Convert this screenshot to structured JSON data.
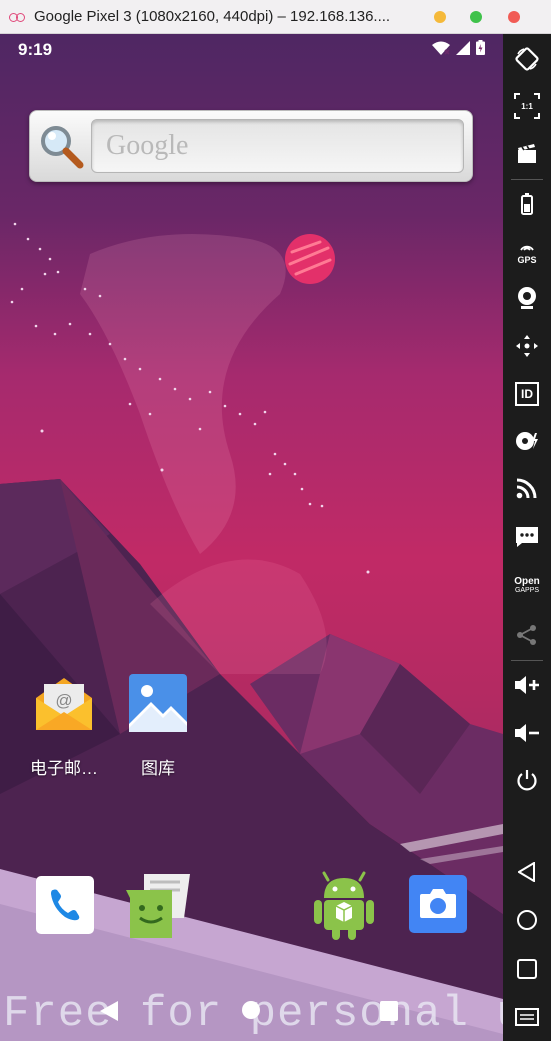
{
  "window": {
    "title": "Google Pixel 3 (1080x2160, 440dpi) – 192.168.136....",
    "buttons": {
      "minimize_color": "#f5b93a",
      "maximize_color": "#3fc24b",
      "close_color": "#f15b55"
    }
  },
  "status_bar": {
    "time": "9:19",
    "icons": [
      "wifi-icon",
      "cell-signal-icon",
      "battery-charging-icon"
    ]
  },
  "search_widget": {
    "placeholder": "Google"
  },
  "apps": [
    {
      "label": "电子邮…",
      "icon": "email-icon"
    },
    {
      "label": "图库",
      "icon": "gallery-icon"
    }
  ],
  "dock": [
    "phone-icon",
    "messaging-icon",
    "android-app-icon",
    "camera-icon"
  ],
  "nav": [
    "back-icon",
    "home-icon",
    "recents-icon"
  ],
  "watermark": "Free for personal use",
  "side_panel": {
    "items": [
      "rotate-icon",
      "pixel-perfect-icon",
      "screencast-icon",
      "battery-icon",
      "gps-icon",
      "webcam-icon",
      "dpad-icon",
      "id-icon",
      "disk-icon",
      "network-icon",
      "sms-icon",
      "open-gapps-icon",
      "share-icon",
      "volume-up-icon",
      "volume-down-icon",
      "power-icon",
      "back-icon",
      "home-icon",
      "recents-icon",
      "menu-icon"
    ],
    "gps_label": "GPS",
    "id_label": "ID",
    "gapps_label_1": "Open",
    "gapps_label_2": "GAPPS",
    "pixel_label": "1:1"
  },
  "colors": {
    "accent": "#c12a66",
    "sky_top": "#4f2763"
  }
}
